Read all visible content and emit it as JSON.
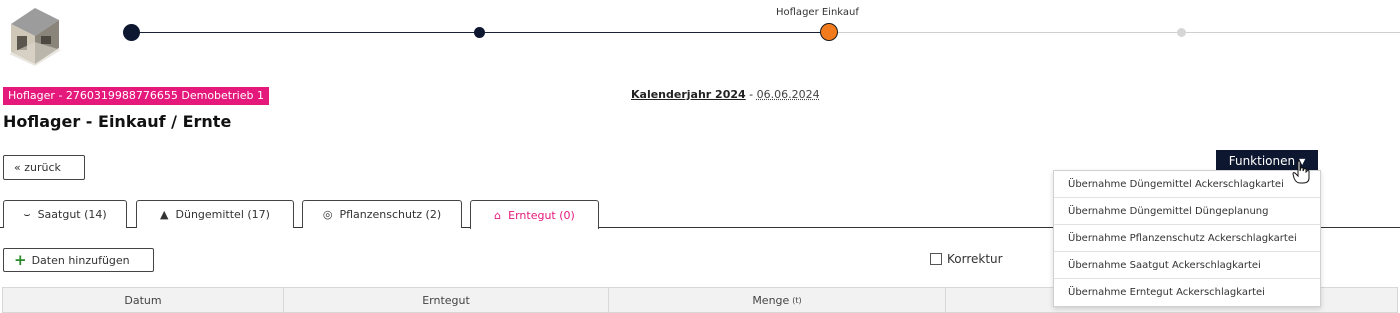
{
  "stepper": {
    "active_label": "Hoflager Einkauf",
    "colors": {
      "done": "#0e1730",
      "active": "#f27b1d",
      "pending": "#d6d6d6"
    }
  },
  "header": {
    "badge": "Hoflager - 2760319988776655 Demobetrieb 1",
    "badge_color": "#e5187c",
    "year_label": "Kalenderjahr 2024",
    "separator": "-",
    "date": "06.06.2024",
    "title": "Hoflager - Einkauf / Ernte"
  },
  "toolbar": {
    "back_label": "« zurück",
    "functions_label": "Funktionen",
    "add_label": "Daten hinzufügen",
    "korrektur_label": "Korrektur"
  },
  "tabs": [
    {
      "label": "Saatgut (14)",
      "icon": "seedling-icon"
    },
    {
      "label": "Düngemittel (17)",
      "icon": "sack-icon"
    },
    {
      "label": "Pflanzenschutz (2)",
      "icon": "spray-icon"
    },
    {
      "label": "Erntegut (0)",
      "icon": "harvest-icon",
      "active": true
    }
  ],
  "table": {
    "columns": [
      "Datum",
      "Erntegut",
      "Menge",
      ""
    ],
    "menge_unit": "(t)"
  },
  "functions_menu": {
    "items": [
      "Übernahme Düngemittel Ackerschlagkartei",
      "Übernahme Düngemittel Düngeplanung",
      "Übernahme Pflanzenschutz Ackerschlagkartei",
      "Übernahme Saatgut Ackerschlagkartei",
      "Übernahme Erntegut Ackerschlagkartei"
    ]
  }
}
